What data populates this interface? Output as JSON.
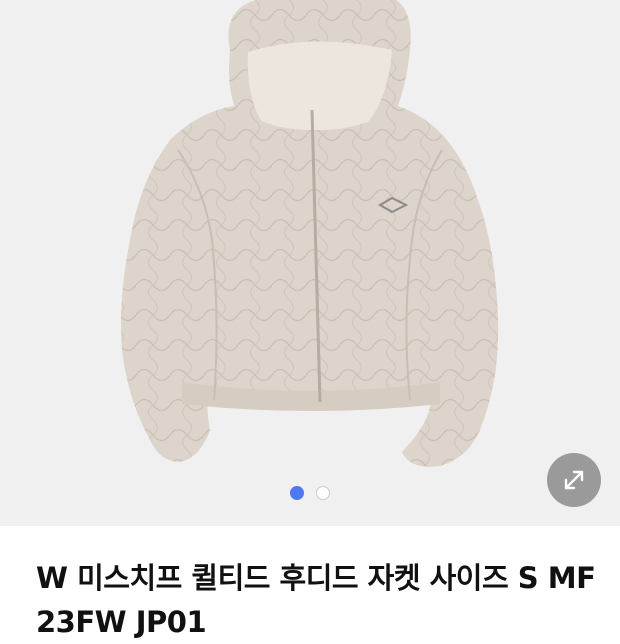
{
  "product": {
    "title": "W 미스치프 퀼티드 후디드 자켓 사이즈 S MF 23FW JP01"
  },
  "gallery": {
    "image_subject": "jacket-photo",
    "pagination": {
      "total": 2,
      "current": 1
    },
    "expand_icon": "expand-diagonal-icon"
  },
  "colors": {
    "background": "#f0f0f0",
    "jacket": "#ddd4cb",
    "active_dot": "#4f79f0",
    "inactive_dot": "#ffffff",
    "expand_button": "#787878"
  }
}
